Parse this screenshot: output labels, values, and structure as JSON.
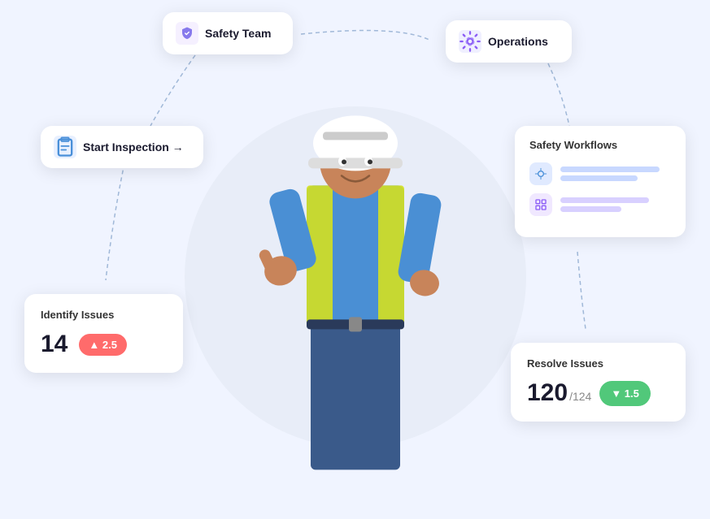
{
  "cards": {
    "safety_team": {
      "label": "Safety Team",
      "icon": "shield"
    },
    "operations": {
      "label": "Operations",
      "icon": "gear"
    },
    "start_inspection": {
      "label": "Start Inspection →",
      "icon": "clipboard"
    },
    "identify_issues": {
      "title": "Identify Issues",
      "count": "14",
      "badge_value": "▲ 2.5"
    },
    "safety_workflows": {
      "title": "Safety Workflows"
    },
    "resolve_issues": {
      "title": "Resolve Issues",
      "count": "120",
      "count_sub": "/124",
      "badge_value": "▼ 1.5"
    }
  },
  "colors": {
    "badge_red": "#ff6b6b",
    "badge_green": "#51c87a",
    "dashed_line": "#a0b4d8",
    "bg_circle": "#e8edf8"
  }
}
